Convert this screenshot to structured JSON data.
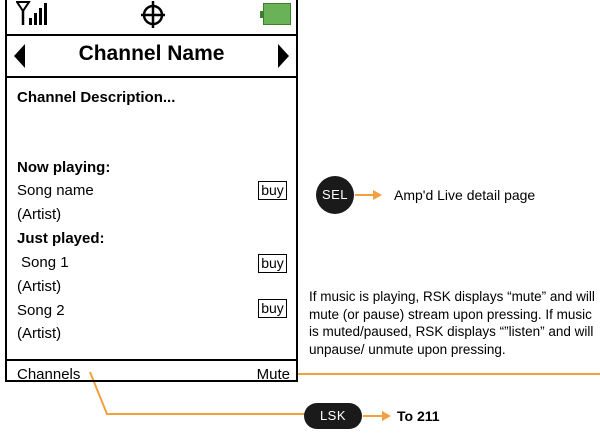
{
  "status_bar": {
    "signal_icon": "signal-bars-icon",
    "gps_icon": "gps-target-icon",
    "battery_icon": "battery-icon",
    "battery_color": "#69b257"
  },
  "header": {
    "title": "Channel Name",
    "prev_icon": "left-arrow-icon",
    "next_icon": "right-arrow-icon"
  },
  "content": {
    "description": "Channel Description...",
    "now_playing_label": "Now playing:",
    "now_playing": {
      "song": "Song name",
      "artist": "(Artist)",
      "buy_label": "buy"
    },
    "just_played_label": "Just played:",
    "just_played": [
      {
        "song": "Song 1",
        "artist": "(Artist)",
        "buy_label": "buy"
      },
      {
        "song": "Song 2",
        "artist": "(Artist)",
        "buy_label": "buy"
      }
    ]
  },
  "softkeys": {
    "left": "Channels",
    "right": "Mute"
  },
  "annotations": {
    "sel_button": "SEL",
    "sel_target": "Amp'd Live detail page",
    "lsk_button": "LSK",
    "lsk_target": "To 211",
    "rsk_note": "If music is playing, RSK displays “mute” and will mute (or pause) stream upon pressing. If music is muted/paused, RSK displays “”listen” and will unpause/ unmute upon pressing.",
    "arrow_color": "#f2a03d"
  }
}
